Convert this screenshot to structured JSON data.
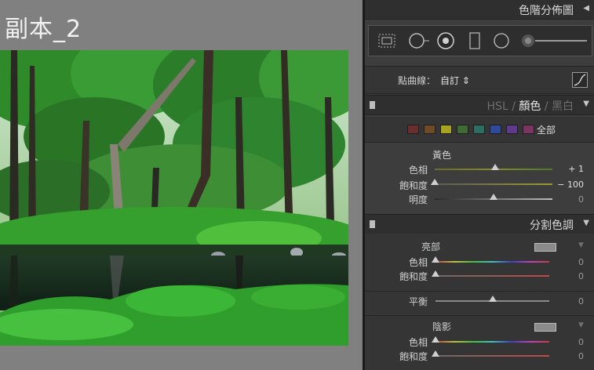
{
  "photo": {
    "title": "副本_2"
  },
  "panel": {
    "histogram": {
      "title": "色階分佈圖",
      "collapse_icon": "triangle-left-icon"
    },
    "tone_curve": {
      "label": "點曲線：",
      "value": "自訂 ⇕",
      "icon": "curve-icon"
    },
    "hsl": {
      "tabs": [
        "HSL",
        "/",
        "顏色",
        "/",
        "黑白"
      ],
      "active_tab": "顏色",
      "swatches": [
        "#6a2e2e",
        "#6e4a26",
        "#a8a420",
        "#3f6b34",
        "#2e6e62",
        "#2f4a9a",
        "#5e3a8e",
        "#7a3560"
      ],
      "all_label": "全部",
      "group_label": "黃色",
      "sliders": [
        {
          "label": "色相",
          "value": "+ 1",
          "pos": 0.51
        },
        {
          "label": "飽和度",
          "value": "− 100",
          "pos": 0.0
        },
        {
          "label": "明度",
          "value": "0",
          "pos": 0.5
        }
      ]
    },
    "split_toning": {
      "title": "分割色調",
      "highlights_label": "亮部",
      "highlights_hue": {
        "label": "色相",
        "value": "0",
        "pos": 0.0
      },
      "highlights_sat": {
        "label": "飽和度",
        "value": "0",
        "pos": 0.0
      },
      "balance": {
        "label": "平衡",
        "value": "0",
        "pos": 0.5
      },
      "shadows_label": "陰影",
      "shadows_hue": {
        "label": "色相",
        "value": "0",
        "pos": 0.0
      },
      "shadows_sat": {
        "label": "飽和度",
        "value": "0",
        "pos": 0.0
      }
    }
  }
}
